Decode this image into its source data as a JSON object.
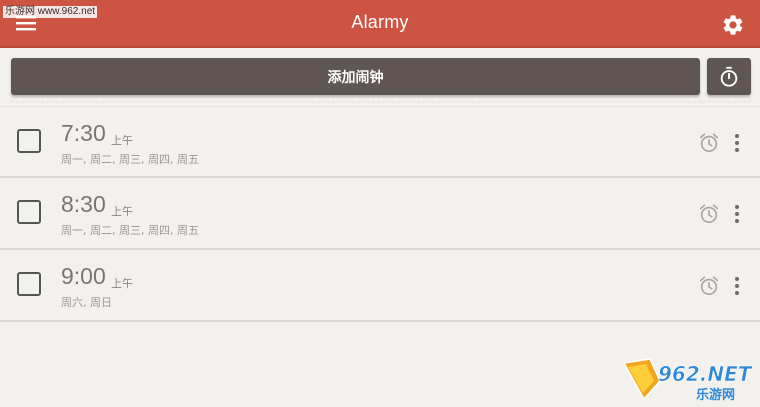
{
  "header": {
    "title": "Alarmy",
    "watermark": "乐游网 www.962.net"
  },
  "actions": {
    "add_alarm_label": "添加闹钟"
  },
  "alarms": [
    {
      "time": "7:30",
      "ampm": "上午",
      "days": "周一, 周二, 周三, 周四, 周五"
    },
    {
      "time": "8:30",
      "ampm": "上午",
      "days": "周一, 周二, 周三, 周四, 周五"
    },
    {
      "time": "9:00",
      "ampm": "上午",
      "days": "周六, 周日"
    }
  ],
  "logo": {
    "text": "962.NET",
    "subtext": "乐游网"
  },
  "colors": {
    "accent": "#cd5443",
    "button": "#5f5552",
    "background": "#f3f1ee"
  },
  "icons": [
    "menu-icon",
    "settings-icon",
    "stopwatch-icon",
    "alarm-clock-icon",
    "more-vert-icon"
  ]
}
